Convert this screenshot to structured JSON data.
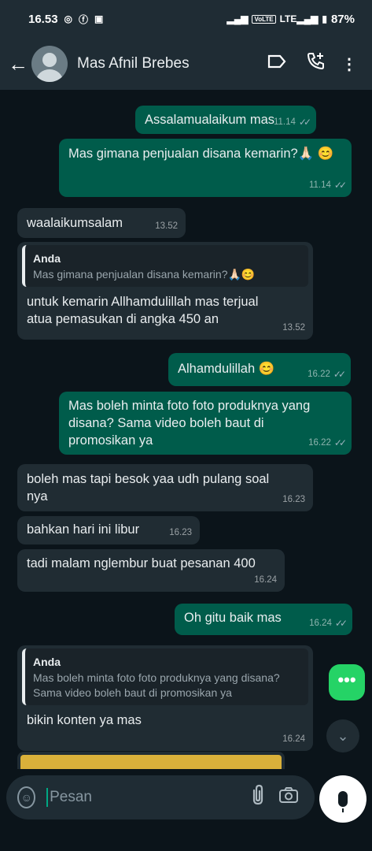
{
  "status_bar": {
    "time": "16.53",
    "volte": "VoLTE",
    "lte": "LTE",
    "battery": "87%"
  },
  "header": {
    "contact_name": "Mas Afnil Brebes"
  },
  "messages": [
    {
      "dir": "out",
      "text": "Assalamualaikum mas",
      "time": "11.14"
    },
    {
      "dir": "out",
      "text": "Mas gimana penjualan disana kemarin?🙏🏻 😊",
      "time": "11.14"
    },
    {
      "dir": "in",
      "text": "waalaikumsalam",
      "time": "13.52"
    },
    {
      "dir": "in",
      "quote_author": "Anda",
      "quote_text": "Mas gimana penjualan disana kemarin?🙏🏻😊",
      "text": "untuk kemarin Allhamdulillah mas terjual atua pemasukan di angka 450 an",
      "time": "13.52"
    },
    {
      "dir": "out",
      "text": "Alhamdulillah 😊",
      "time": "16.22"
    },
    {
      "dir": "out",
      "text": "Mas boleh minta foto foto produknya yang disana? Sama video boleh baut di promosikan ya",
      "time": "16.22"
    },
    {
      "dir": "in",
      "text": "boleh mas tapi besok yaa udh pulang soal nya",
      "time": "16.23"
    },
    {
      "dir": "in",
      "text": "bahkan hari ini libur",
      "time": "16.23"
    },
    {
      "dir": "in",
      "text": "tadi malam nglembur buat pesanan 400",
      "time": "16.24"
    },
    {
      "dir": "out",
      "text": "Oh gitu baik mas",
      "time": "16.24"
    },
    {
      "dir": "in",
      "quote_author": "Anda",
      "quote_text": "Mas boleh minta foto foto produknya yang disana? Sama video boleh baut di promosikan ya",
      "text": "bikin konten ya mas",
      "time": "16.24"
    }
  ],
  "input": {
    "placeholder": "Pesan"
  },
  "colors": {
    "outgoing_bubble": "#005c4b",
    "incoming_bubble": "#202c33",
    "background": "#0b141a",
    "accent": "#25d366"
  },
  "icons": {
    "back": "arrow-left",
    "label": "label-tag",
    "call_add": "phone-plus",
    "menu": "three-dots-vertical",
    "sticker": "sticker",
    "attach": "paperclip",
    "camera": "camera",
    "mic": "microphone"
  }
}
